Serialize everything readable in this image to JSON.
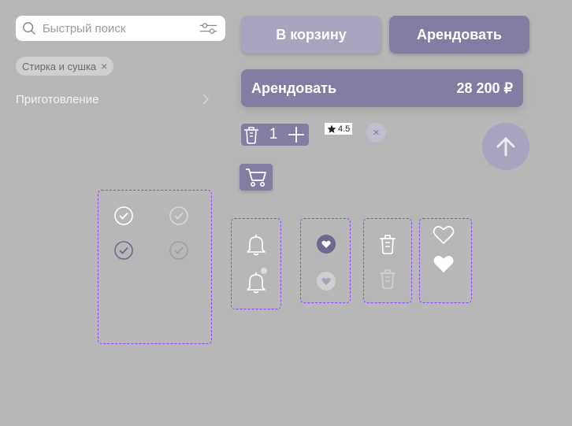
{
  "search": {
    "placeholder": "Быстрый поиск",
    "value": ""
  },
  "filter_chip": {
    "label": "Стирка и сушка",
    "close": "×"
  },
  "category": {
    "label": "Приготовление"
  },
  "buttons": {
    "add_to_cart": "В корзину",
    "rent": "Арендовать",
    "rent_wide_label": "Арендовать",
    "rent_wide_price": "28 200 ₽"
  },
  "stepper": {
    "quantity": "1"
  },
  "rating": {
    "value": "4.5"
  },
  "small_close": {
    "label": "×"
  },
  "colors": {
    "background": "#b7b7b7",
    "accent": "#837ca3",
    "accent_light": "#a8a4be",
    "dashed_frame": "#8b45ff"
  },
  "icons": [
    "search-icon",
    "filter-icon",
    "chevron-right-icon",
    "trash-icon",
    "plus-icon",
    "star-icon",
    "arrow-up-icon",
    "cart-icon",
    "check-circle-icon",
    "bell-icon",
    "heart-badge-icon",
    "heart-icon"
  ]
}
